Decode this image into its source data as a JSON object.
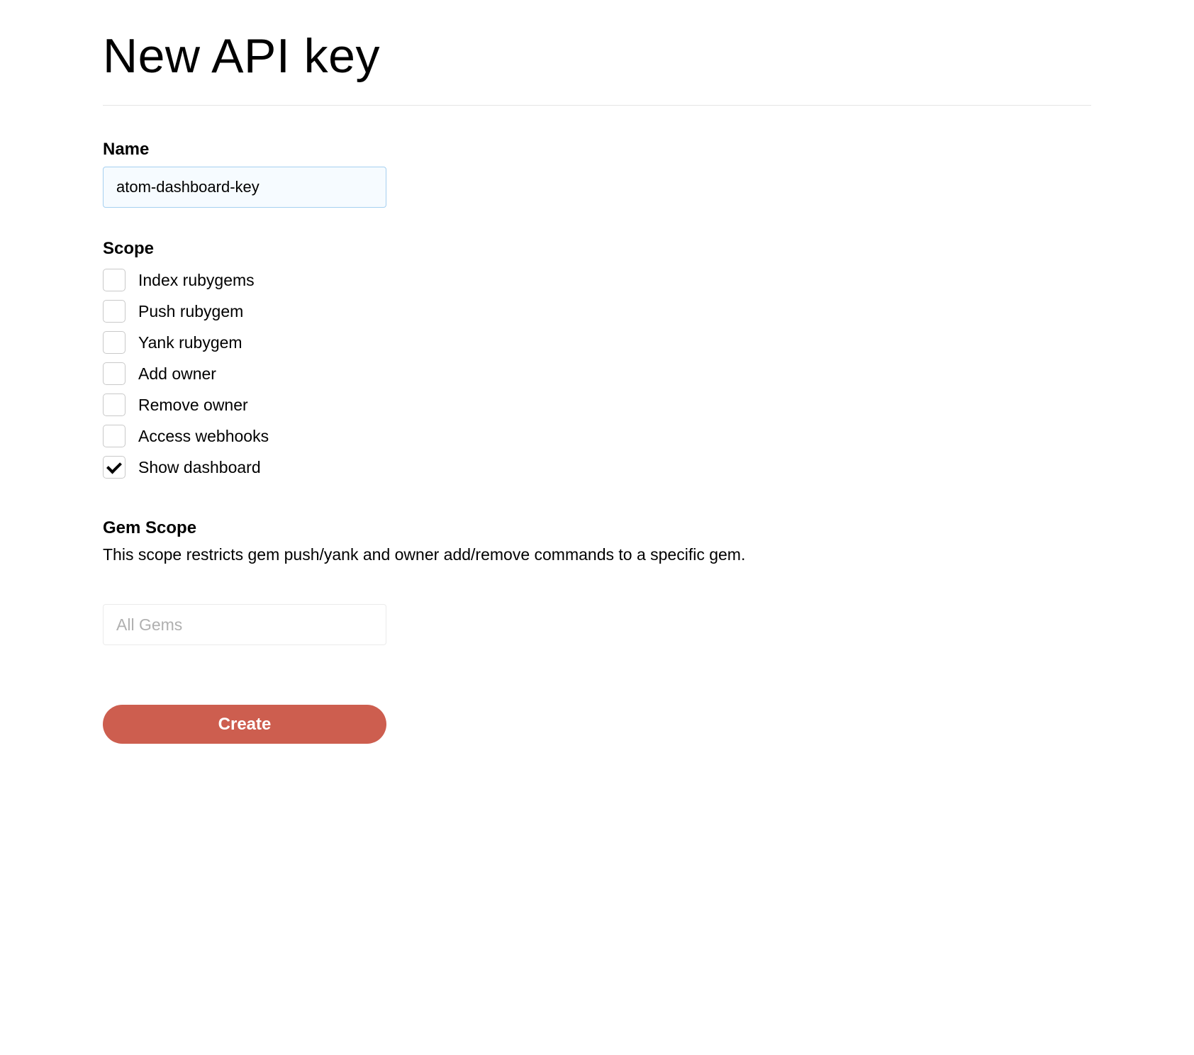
{
  "page": {
    "title": "New API key"
  },
  "form": {
    "name_label": "Name",
    "name_value": "atom-dashboard-key",
    "scope_label": "Scope",
    "scopes": [
      {
        "label": "Index rubygems",
        "checked": false
      },
      {
        "label": "Push rubygem",
        "checked": false
      },
      {
        "label": "Yank rubygem",
        "checked": false
      },
      {
        "label": "Add owner",
        "checked": false
      },
      {
        "label": "Remove owner",
        "checked": false
      },
      {
        "label": "Access webhooks",
        "checked": false
      },
      {
        "label": "Show dashboard",
        "checked": true
      }
    ],
    "gem_scope_label": "Gem Scope",
    "gem_scope_description": "This scope restricts gem push/yank and owner add/remove commands to a specific gem.",
    "gem_scope_value": "All Gems",
    "submit_label": "Create"
  }
}
